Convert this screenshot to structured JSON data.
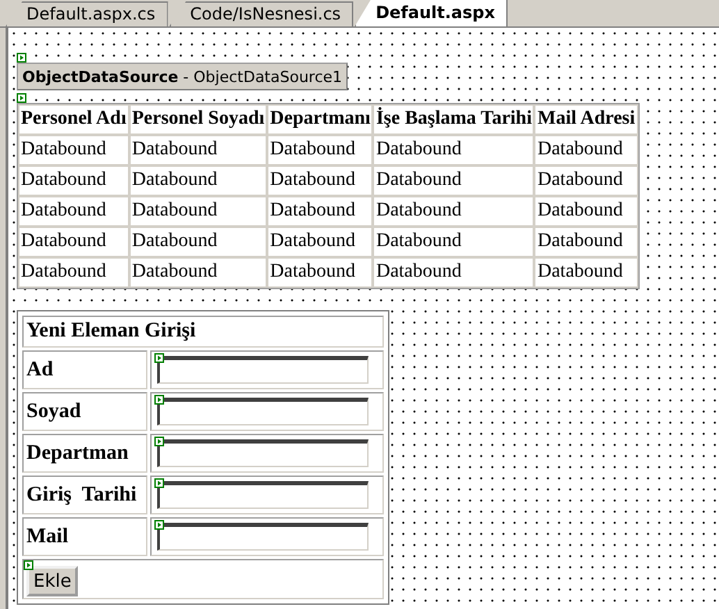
{
  "tabs": [
    {
      "label": "Default.aspx.cs",
      "selected": false
    },
    {
      "label": "Code/IsNesnesi.cs",
      "selected": false
    },
    {
      "label": "Default.aspx",
      "selected": true
    }
  ],
  "data_source": {
    "caption": "**ObjectDataSource** - ObjectDataSource1"
  },
  "grid": {
    "columns": [
      "Personel Adı",
      "Personel Soyadı",
      "Departmanı",
      "İşe Başlama Tarihi",
      "Mail Adresi"
    ],
    "rows": [
      [
        "Databound",
        "Databound",
        "Databound",
        "Databound",
        "Databound"
      ],
      [
        "Databound",
        "Databound",
        "Databound",
        "Databound",
        "Databound"
      ],
      [
        "Databound",
        "Databound",
        "Databound",
        "Databound",
        "Databound"
      ],
      [
        "Databound",
        "Databound",
        "Databound",
        "Databound",
        "Databound"
      ],
      [
        "Databound",
        "Databound",
        "Databound",
        "Databound",
        "Databound"
      ]
    ]
  },
  "form": {
    "title": "Yeni Eleman Girişi",
    "fields": [
      {
        "label": "Ad"
      },
      {
        "label": "Soyad"
      },
      {
        "label": "Departman"
      },
      {
        "label": "Giriş  Tarihi"
      },
      {
        "label": "Mail"
      }
    ],
    "button": "Ekle"
  }
}
